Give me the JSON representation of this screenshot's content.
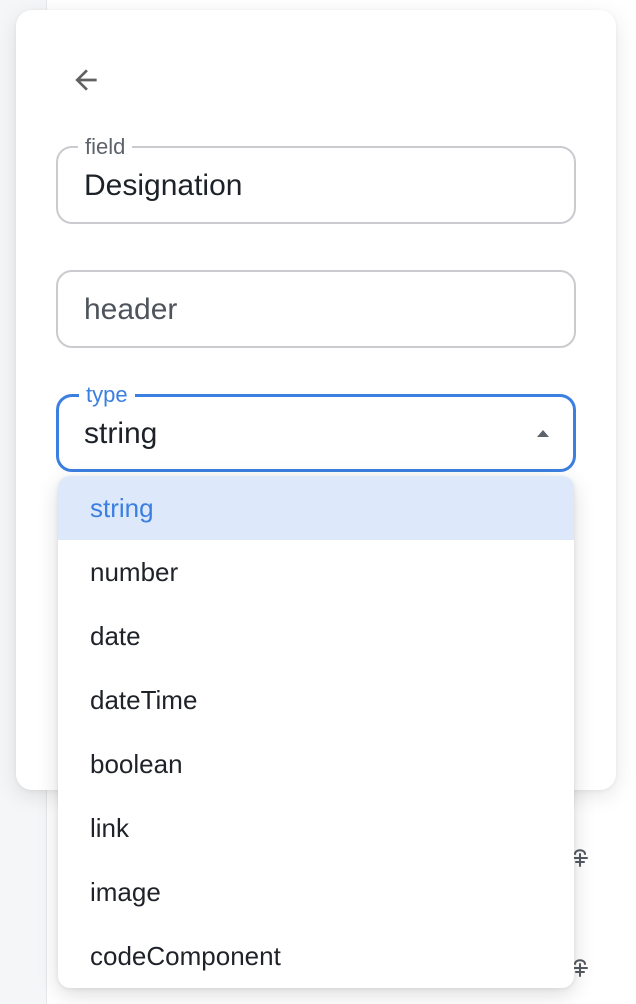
{
  "form": {
    "back_icon": "arrow-left-icon",
    "field": {
      "label": "field",
      "value": "Designation"
    },
    "header": {
      "placeholder": "header"
    },
    "type": {
      "label": "type",
      "value": "string"
    }
  },
  "dropdown": {
    "selected": "string",
    "options": [
      {
        "label": "string"
      },
      {
        "label": "number"
      },
      {
        "label": "date"
      },
      {
        "label": "dateTime"
      },
      {
        "label": "boolean"
      },
      {
        "label": "link"
      },
      {
        "label": "image"
      },
      {
        "label": "codeComponent"
      }
    ]
  },
  "colors": {
    "accent": "#3b7fe0",
    "selected_bg": "#dde9fb",
    "border": "#c9cbcf"
  }
}
